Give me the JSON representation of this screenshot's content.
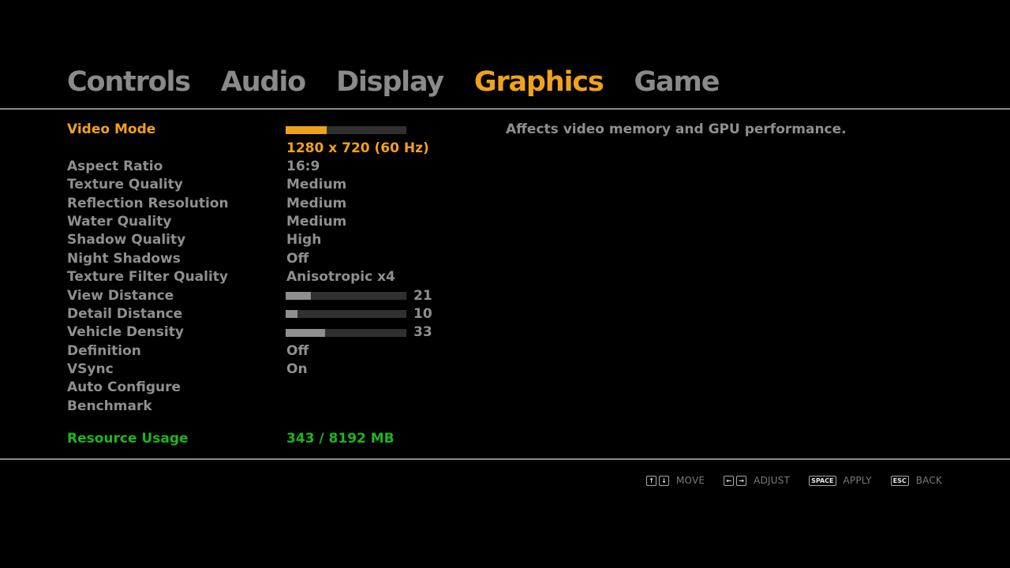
{
  "tabs": [
    {
      "label": "Controls",
      "active": false
    },
    {
      "label": "Audio",
      "active": false
    },
    {
      "label": "Display",
      "active": false
    },
    {
      "label": "Graphics",
      "active": true
    },
    {
      "label": "Game",
      "active": false
    }
  ],
  "settings": {
    "video_mode": {
      "label": "Video Mode",
      "value": "1280 x 720 (60 Hz)",
      "slider_fraction": 0.34
    },
    "aspect_ratio": {
      "label": "Aspect Ratio",
      "value": "16:9"
    },
    "texture_quality": {
      "label": "Texture Quality",
      "value": "Medium"
    },
    "reflection_resolution": {
      "label": "Reflection Resolution",
      "value": "Medium"
    },
    "water_quality": {
      "label": "Water Quality",
      "value": "Medium"
    },
    "shadow_quality": {
      "label": "Shadow Quality",
      "value": "High"
    },
    "night_shadows": {
      "label": "Night Shadows",
      "value": "Off"
    },
    "texture_filter_quality": {
      "label": "Texture Filter Quality",
      "value": "Anisotropic x4"
    },
    "view_distance": {
      "label": "View Distance",
      "value": "21",
      "percent": 21
    },
    "detail_distance": {
      "label": "Detail Distance",
      "value": "10",
      "percent": 10
    },
    "vehicle_density": {
      "label": "Vehicle Density",
      "value": "33",
      "percent": 33
    },
    "definition": {
      "label": "Definition",
      "value": "Off"
    },
    "vsync": {
      "label": "VSync",
      "value": "On"
    },
    "auto_configure": {
      "label": "Auto Configure"
    },
    "benchmark": {
      "label": "Benchmark"
    }
  },
  "resource": {
    "label": "Resource Usage",
    "value": "343 / 8192 MB"
  },
  "description": "Affects video memory and GPU performance.",
  "hints": [
    {
      "keys": [
        "↑",
        "↓"
      ],
      "label": "MOVE"
    },
    {
      "keys": [
        "←",
        "→"
      ],
      "label": "ADJUST"
    },
    {
      "keys": [
        "SPACE"
      ],
      "label": "APPLY"
    },
    {
      "keys": [
        "ESC"
      ],
      "label": "BACK"
    }
  ],
  "colors": {
    "accent": "#f0a21a",
    "text": "#8f8f8f",
    "resource": "#1fb51f",
    "background": "#000000"
  }
}
